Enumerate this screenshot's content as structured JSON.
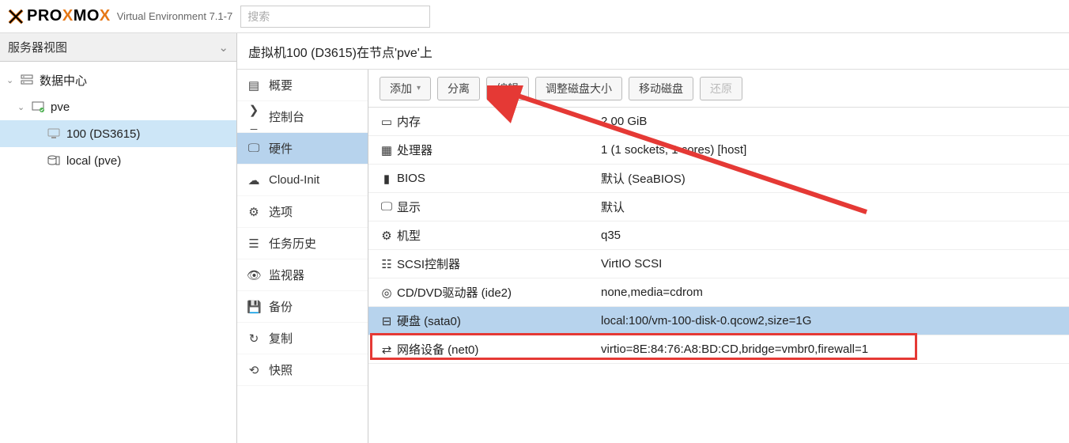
{
  "header": {
    "brand_pro": "PRO",
    "brand_mo": "MO",
    "version": "Virtual Environment 7.1-7",
    "search_placeholder": "搜索"
  },
  "tree": {
    "header": "服务器视图",
    "items": [
      {
        "label": "数据中心",
        "icon": "server"
      },
      {
        "label": "pve",
        "icon": "node"
      },
      {
        "label": "100 (DS3615)",
        "icon": "vm",
        "selected": true
      },
      {
        "label": "local (pve)",
        "icon": "storage"
      }
    ]
  },
  "content": {
    "title": "虚拟机100 (D3615)在节点'pve'上"
  },
  "submenu": [
    {
      "label": "概要",
      "icon": "book"
    },
    {
      "label": "控制台",
      "icon": "terminal"
    },
    {
      "label": "硬件",
      "icon": "monitor",
      "selected": true
    },
    {
      "label": "Cloud-Init",
      "icon": "cloud"
    },
    {
      "label": "选项",
      "icon": "gear"
    },
    {
      "label": "任务历史",
      "icon": "list"
    },
    {
      "label": "监视器",
      "icon": "eye"
    },
    {
      "label": "备份",
      "icon": "save"
    },
    {
      "label": "复制",
      "icon": "retweet"
    },
    {
      "label": "快照",
      "icon": "history"
    }
  ],
  "toolbar": {
    "add": "添加",
    "detach": "分离",
    "edit": "编辑",
    "resize": "调整磁盘大小",
    "move": "移动磁盘",
    "restore": "还原"
  },
  "hardware": [
    {
      "icon": "memory",
      "name": "内存",
      "value": "2.00 GiB"
    },
    {
      "icon": "cpu",
      "name": "处理器",
      "value": "1 (1 sockets, 1 cores) [host]"
    },
    {
      "icon": "bios",
      "name": "BIOS",
      "value": "默认 (SeaBIOS)"
    },
    {
      "icon": "display",
      "name": "显示",
      "value": "默认"
    },
    {
      "icon": "machine",
      "name": "机型",
      "value": "q35"
    },
    {
      "icon": "scsi",
      "name": "SCSI控制器",
      "value": "VirtIO SCSI"
    },
    {
      "icon": "disc",
      "name": "CD/DVD驱动器 (ide2)",
      "value": "none,media=cdrom"
    },
    {
      "icon": "hdd",
      "name": "硬盘 (sata0)",
      "value": "local:100/vm-100-disk-0.qcow2,size=1G",
      "selected": true
    },
    {
      "icon": "net",
      "name": "网络设备 (net0)",
      "value": "virtio=8E:84:76:A8:BD:CD,bridge=vmbr0,firewall=1"
    }
  ]
}
